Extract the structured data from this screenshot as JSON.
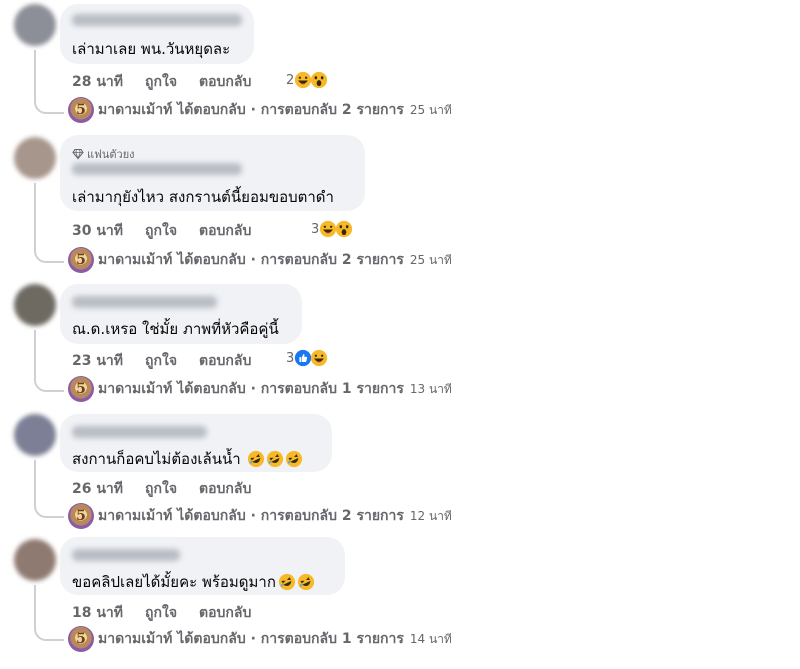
{
  "comments": [
    {
      "text": "เล่ามาเลย พน.วันหยุดละ",
      "time": "28 นาที",
      "like": "ถูกใจ",
      "reply": "ตอบกลับ",
      "react_count": "2",
      "reactions": [
        "haha-icon",
        "wow-icon"
      ],
      "fan_badge": "",
      "page_name": "มาดามเม้าท์",
      "reply_summary": "ได้ตอบกลับ · การตอบกลับ 2 รายการ",
      "reply_time": "25 นาที",
      "avatar_color": "#8d8f98"
    },
    {
      "text": "เล่ามากุยังไหว สงกรานต์นี้ยอมขอบตาดำ",
      "time": "30 นาที",
      "like": "ถูกใจ",
      "reply": "ตอบกลับ",
      "react_count": "3",
      "reactions": [
        "haha-icon",
        "wow-icon"
      ],
      "fan_badge": "แฟนตัวยง",
      "page_name": "มาดามเม้าท์",
      "reply_summary": "ได้ตอบกลับ · การตอบกลับ 2 รายการ",
      "reply_time": "25 นาที",
      "avatar_color": "#a7968c"
    },
    {
      "text": "ณ.ด.เหรอ ใช่มั้ย ภาพที่หัวคือคู่นี้",
      "time": "23 นาที",
      "like": "ถูกใจ",
      "reply": "ตอบกลับ",
      "react_count": "3",
      "reactions": [
        "like-icon",
        "haha-icon"
      ],
      "fan_badge": "",
      "page_name": "มาดามเม้าท์",
      "reply_summary": "ได้ตอบกลับ · การตอบกลับ 1 รายการ",
      "reply_time": "13 นาที",
      "avatar_color": "#6e6a62"
    },
    {
      "text": "สงกานก็อคบไม่ต้องเล้นน้ำ",
      "time": "26 นาที",
      "like": "ถูกใจ",
      "reply": "ตอบกลับ",
      "react_count": "",
      "reactions": [],
      "inline_emoji": [
        "rofl-icon",
        "rofl-icon",
        "rofl-icon"
      ],
      "fan_badge": "",
      "page_name": "มาดามเม้าท์",
      "reply_summary": "ได้ตอบกลับ · การตอบกลับ 2 รายการ",
      "reply_time": "12 นาที",
      "avatar_color": "#7c7f95"
    },
    {
      "text": "ขอคลิปเลยได้มั้ยคะ พร้อมดูมาก",
      "time": "18 นาที",
      "like": "ถูกใจ",
      "reply": "ตอบกลับ",
      "react_count": "",
      "reactions": [],
      "inline_emoji": [
        "rofl-icon",
        "rofl-icon"
      ],
      "fan_badge": "",
      "page_name": "มาดามเม้าท์",
      "reply_summary": "ได้ตอบกลับ · การตอบกลับ 1 รายการ",
      "reply_time": "14 นาที",
      "avatar_color": "#8e7a70"
    }
  ],
  "colors": {
    "bubble": "#f0f2f5",
    "meta_text": "#65676b",
    "like_blue": "#1877f2",
    "emoji_yellow": "#f7b928"
  }
}
